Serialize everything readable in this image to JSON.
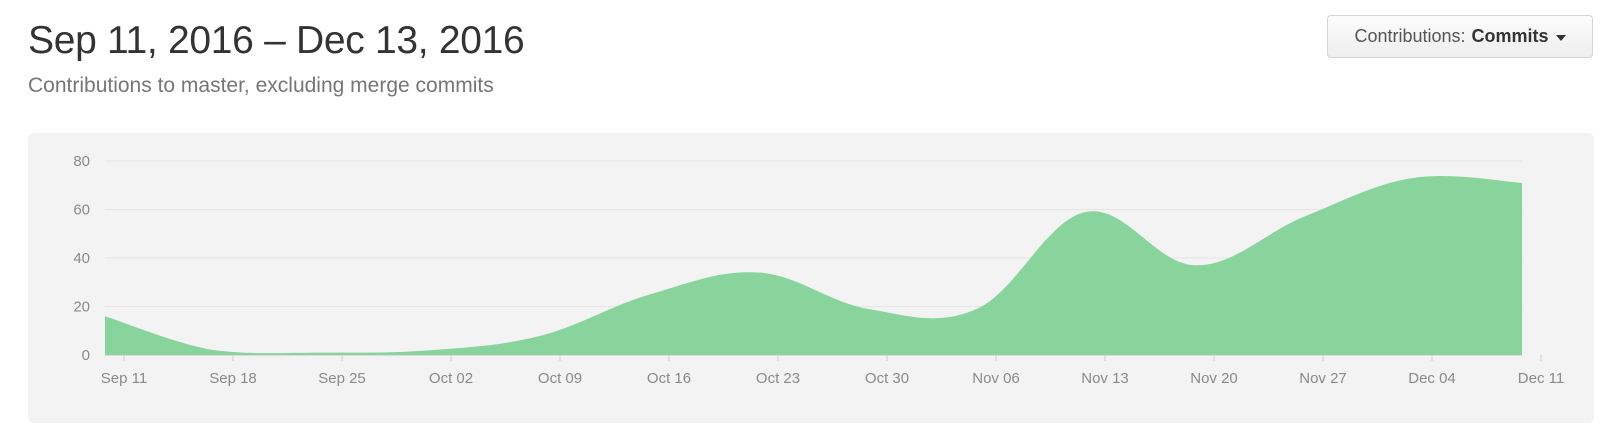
{
  "header": {
    "title": "Sep 11, 2016 – Dec 13, 2016",
    "subtitle": "Contributions to master, excluding merge commits"
  },
  "contrib_button": {
    "prefix": "Contributions:",
    "value": "Commits"
  },
  "colors": {
    "area_fill": "#89d39d",
    "panel_bg": "#f3f3f3",
    "grid": "#e6e6e6",
    "tick_text": "#8a8a8a"
  },
  "chart_data": {
    "type": "area",
    "x": [
      "Sep 11",
      "Sep 18",
      "Sep 25",
      "Oct 02",
      "Oct 09",
      "Oct 16",
      "Oct 23",
      "Oct 30",
      "Nov 06",
      "Nov 13",
      "Nov 20",
      "Nov 27",
      "Dec 04",
      "Dec 11"
    ],
    "x_tick_labels": [
      "Sep 11",
      "Sep 18",
      "Sep 25",
      "Oct 02",
      "Oct 09",
      "Oct 16",
      "Oct 23",
      "Oct 30",
      "Nov 06",
      "Nov 13",
      "Nov 20",
      "Nov 27",
      "Dec 04",
      "Dec 11"
    ],
    "series": [
      {
        "values": [
          16,
          2,
          1,
          2,
          8,
          25,
          34,
          19,
          19,
          59,
          37,
          57,
          73,
          71
        ]
      }
    ],
    "y_ticks": [
      0,
      20,
      40,
      60,
      80
    ],
    "ylim": [
      0,
      80
    ],
    "grid": true,
    "title": "",
    "xlabel": "",
    "ylabel": ""
  }
}
